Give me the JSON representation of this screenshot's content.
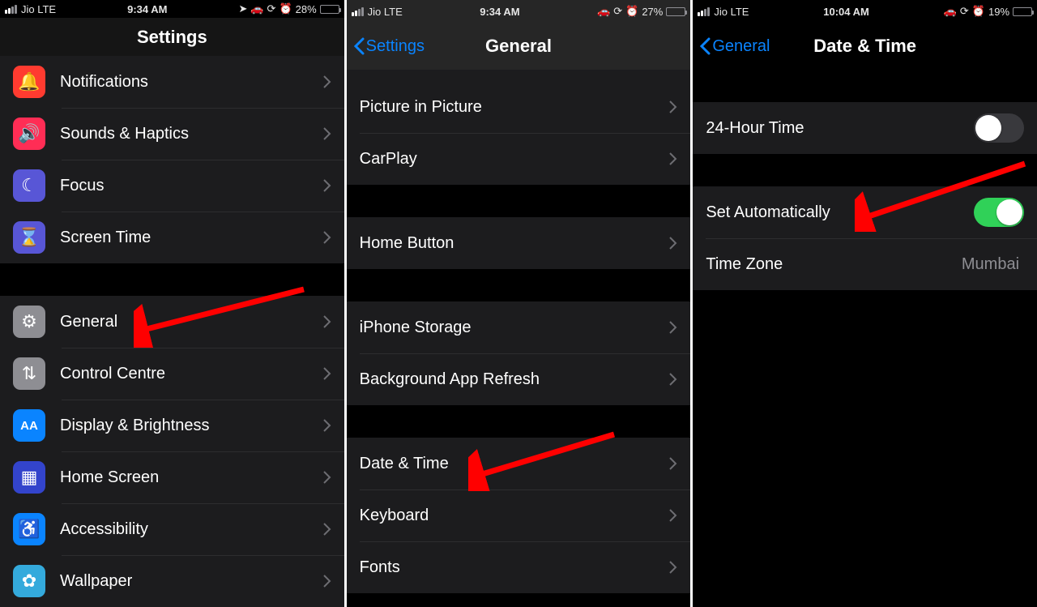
{
  "phones": [
    {
      "status": {
        "carrier": "Jio  LTE",
        "time": "9:34 AM",
        "battery_pct": "28%",
        "battery_fill": "28%",
        "low": false,
        "extra_left_icon": true
      },
      "header": {
        "title": "Settings",
        "back": null
      },
      "arrow": {
        "target": "General"
      },
      "groups": [
        {
          "rows": [
            {
              "icon": "bell",
              "icon_bg": "#ff3b30",
              "label": "Notifications"
            },
            {
              "icon": "speaker",
              "icon_bg": "#ff2d55",
              "label": "Sounds & Haptics"
            },
            {
              "icon": "moon",
              "icon_bg": "#5856d6",
              "label": "Focus"
            },
            {
              "icon": "hourglass",
              "icon_bg": "#5856d6",
              "label": "Screen Time"
            }
          ]
        },
        {
          "rows": [
            {
              "icon": "gear",
              "icon_bg": "#8e8e93",
              "label": "General"
            },
            {
              "icon": "switches",
              "icon_bg": "#8e8e93",
              "label": "Control Centre"
            },
            {
              "icon": "aa",
              "icon_bg": "#0a84ff",
              "label": "Display & Brightness"
            },
            {
              "icon": "grid",
              "icon_bg": "#3344cc",
              "label": "Home Screen"
            },
            {
              "icon": "accessibility",
              "icon_bg": "#0a84ff",
              "label": "Accessibility"
            },
            {
              "icon": "flower",
              "icon_bg": "#34aadc",
              "label": "Wallpaper"
            }
          ]
        }
      ]
    },
    {
      "status": {
        "carrier": "Jio  LTE",
        "time": "9:34 AM",
        "battery_pct": "27%",
        "battery_fill": "27%",
        "low": false,
        "extra_left_icon": false
      },
      "header": {
        "title": "General",
        "back": "Settings"
      },
      "arrow": {
        "target": "Date & Time"
      },
      "groups": [
        {
          "rows": [
            {
              "label": "Picture in Picture"
            },
            {
              "label": "CarPlay"
            }
          ]
        },
        {
          "rows": [
            {
              "label": "Home Button"
            }
          ]
        },
        {
          "rows": [
            {
              "label": "iPhone Storage"
            },
            {
              "label": "Background App Refresh"
            }
          ]
        },
        {
          "rows": [
            {
              "label": "Date & Time"
            },
            {
              "label": "Keyboard"
            },
            {
              "label": "Fonts"
            }
          ]
        }
      ]
    },
    {
      "status": {
        "carrier": "Jio  LTE",
        "time": "10:04 AM",
        "battery_pct": "19%",
        "battery_fill": "19%",
        "low": true,
        "extra_left_icon": false
      },
      "header": {
        "title": "Date & Time",
        "back": "General"
      },
      "arrow": {
        "target": "Set Automatically"
      },
      "groups": [
        {
          "rows": [
            {
              "label": "24-Hour Time",
              "toggle": false
            }
          ]
        },
        {
          "rows": [
            {
              "label": "Set Automatically",
              "toggle": true
            },
            {
              "label": "Time Zone",
              "value": "Mumbai",
              "no_chev": true
            }
          ]
        }
      ]
    }
  ],
  "icon_glyphs": {
    "bell": "🔔",
    "speaker": "🔊",
    "moon": "☾",
    "hourglass": "⌛",
    "gear": "⚙",
    "switches": "⇅",
    "aa": "AA",
    "grid": "▦",
    "accessibility": "♿",
    "flower": "✿"
  },
  "status_glyphs": {
    "location": "➤",
    "car": "🚗",
    "lock_rotate": "⟳",
    "alarm": "⏰"
  }
}
